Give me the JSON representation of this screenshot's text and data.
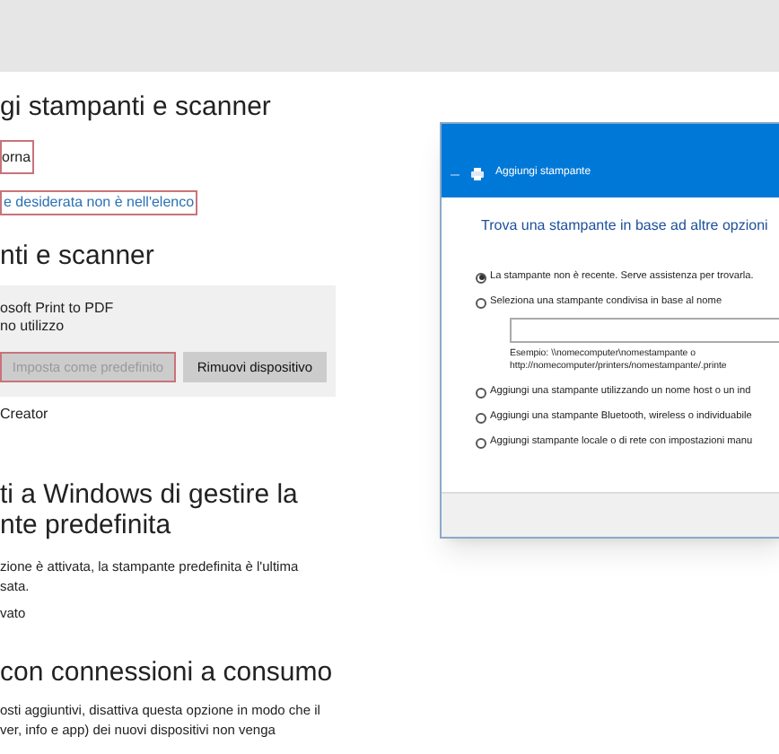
{
  "settings": {
    "heading": "gi stampanti e scanner",
    "refresh_button": {
      "label": "orna",
      "highlighted": true
    },
    "missing_link": {
      "label": "e desiderata non è nell'elenco",
      "highlighted": true
    },
    "devices_heading": "nti e scanner",
    "device": {
      "name": "osoft Print to PDF",
      "status": "no utilizzo",
      "buttons": [
        {
          "label": "Imposta come predefinito",
          "disabled": true,
          "highlighted": true
        },
        {
          "label": "Rimuovi dispositivo",
          "disabled": false,
          "highlighted": false
        }
      ]
    },
    "device2": "Creator",
    "default_heading": [
      "ti a Windows di gestire la",
      "nte predefinita"
    ],
    "default_description": [
      "zione è attivata, la stampante predefinita è l'ultima",
      "sata."
    ],
    "default_state": "vato",
    "metered_heading": "con connessioni a consumo",
    "metered_description": [
      "osti aggiuntivi, disattiva questa opzione in modo che il",
      "ver, info e app) dei nuovi dispositivi non venga"
    ]
  },
  "dialog": {
    "title": "Aggiungi stampante",
    "heading": "Trova una stampante in base ad altre opzioni",
    "options": [
      {
        "label": "La stampante non è recente. Serve assistenza per trovarla.",
        "selected": true
      },
      {
        "label": "Seleziona una stampante condivisa in base al nome",
        "selected": false,
        "kind": "field",
        "example": [
          "Esempio: \\\\nomecomputer\\nomestampante o",
          "http://nomecomputer/printers/nomestampante/.printe"
        ]
      },
      {
        "label": "Aggiungi una stampante utilizzando un nome host o un ind",
        "selected": false
      },
      {
        "label": "Aggiungi una stampante Bluetooth, wireless o individuabile",
        "selected": false
      },
      {
        "label": "Aggiungi stampante locale o di rete con impostazioni manu",
        "selected": false
      }
    ]
  }
}
